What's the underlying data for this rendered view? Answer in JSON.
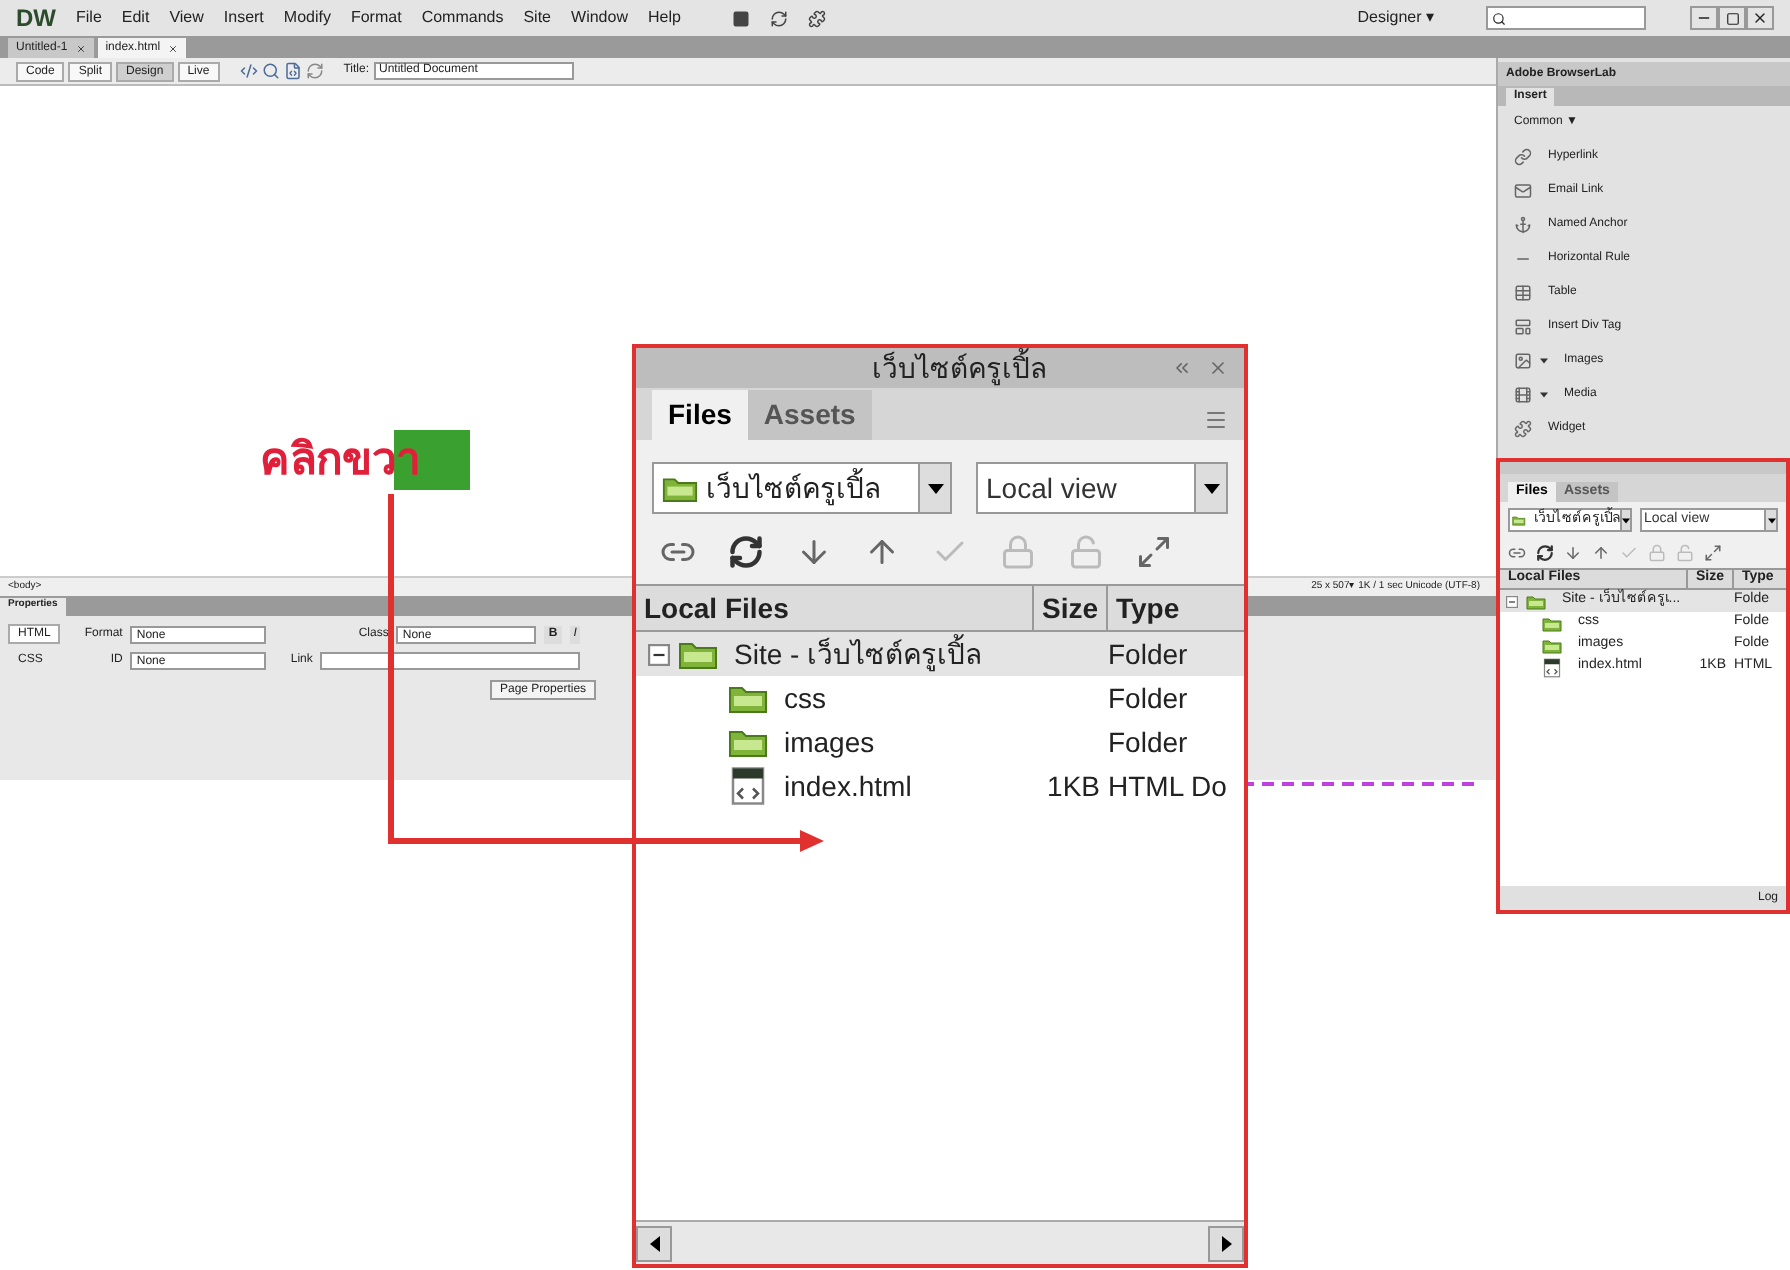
{
  "menu_bar": {
    "logo": "DW",
    "items": [
      "File",
      "Edit",
      "View",
      "Insert",
      "Modify",
      "Format",
      "Commands",
      "Site",
      "Window",
      "Help"
    ],
    "workspace": "Designer ▾"
  },
  "document_tabs": [
    {
      "label": "Untitled-1",
      "selected": false
    },
    {
      "label": "index.html",
      "selected": true
    }
  ],
  "doc_toolbar": {
    "view_buttons": [
      {
        "label": "Code",
        "selected": false
      },
      {
        "label": "Split",
        "selected": false
      },
      {
        "label": "Design",
        "selected": true
      },
      {
        "label": "Live",
        "selected": false
      }
    ],
    "title_label": "Title:",
    "title_value": "Untitled Document"
  },
  "status_bar": {
    "tag": "<body>",
    "info": "25 x 507▾ 1K / 1 sec Unicode (UTF-8)"
  },
  "properties": {
    "title": "Properties",
    "modes": [
      {
        "label": "HTML",
        "selected": true
      },
      {
        "label": "CSS",
        "selected": false
      }
    ],
    "format_label": "Format",
    "format_value": "None",
    "id_label": "ID",
    "id_value": "None",
    "class_label": "Class",
    "class_value": "None",
    "bold": "B",
    "italic": "I",
    "link_label": "Link",
    "page_properties": "Page Properties"
  },
  "right_panel": {
    "browserlab": "Adobe BrowserLab",
    "insert_tab": "Insert",
    "category": "Common ▼",
    "insert_items": [
      {
        "label": "Hyperlink",
        "dropdown": false
      },
      {
        "label": "Email Link",
        "dropdown": false
      },
      {
        "label": "Named Anchor",
        "dropdown": false
      },
      {
        "label": "Horizontal Rule",
        "dropdown": false
      },
      {
        "label": "Table",
        "dropdown": false
      },
      {
        "label": "Insert Div Tag",
        "dropdown": false
      },
      {
        "label": "Images",
        "dropdown": true
      },
      {
        "label": "Media",
        "dropdown": true
      },
      {
        "label": "Widget",
        "dropdown": false
      }
    ],
    "files": {
      "tabs": [
        {
          "label": "Files",
          "selected": true
        },
        {
          "label": "Assets",
          "selected": false
        }
      ],
      "site": "เว็บไซต์ครูเปิ้ล",
      "view": "Local view",
      "columns": [
        "Local Files",
        "Size",
        "Type"
      ],
      "rows": [
        {
          "name": "Site - เว็บไซต์ครูเ...",
          "type": "Folde",
          "kind": "folder",
          "expanded": true,
          "children": [
            {
              "name": "css",
              "type": "Folde",
              "kind": "folder"
            },
            {
              "name": "images",
              "type": "Folde",
              "kind": "folder"
            },
            {
              "name": "index.html",
              "size": "1KB",
              "type": "HTML",
              "kind": "file"
            }
          ]
        }
      ],
      "log": "Log"
    }
  },
  "zoom_panel": {
    "title": "เว็บไซต์ครูเปิ้ล",
    "tabs": [
      {
        "label": "Files",
        "selected": true
      },
      {
        "label": "Assets",
        "selected": false
      }
    ],
    "site": "เว็บไซต์ครูเปิ้ล",
    "view": "Local view",
    "columns": [
      "Local Files",
      "Size",
      "Type"
    ],
    "rows": [
      {
        "name": "Site -  เว็บไซต์ครูเปิ้ล",
        "type": "Folder",
        "kind": "folder",
        "expanded": true,
        "children": [
          {
            "name": "css",
            "type": "Folder",
            "kind": "folder"
          },
          {
            "name": "images",
            "type": "Folder",
            "kind": "folder"
          },
          {
            "name": "index.html",
            "size": "1KB",
            "type": "HTML Do",
            "kind": "file"
          }
        ]
      }
    ]
  },
  "annotation": {
    "label": "คลิกขวา"
  }
}
